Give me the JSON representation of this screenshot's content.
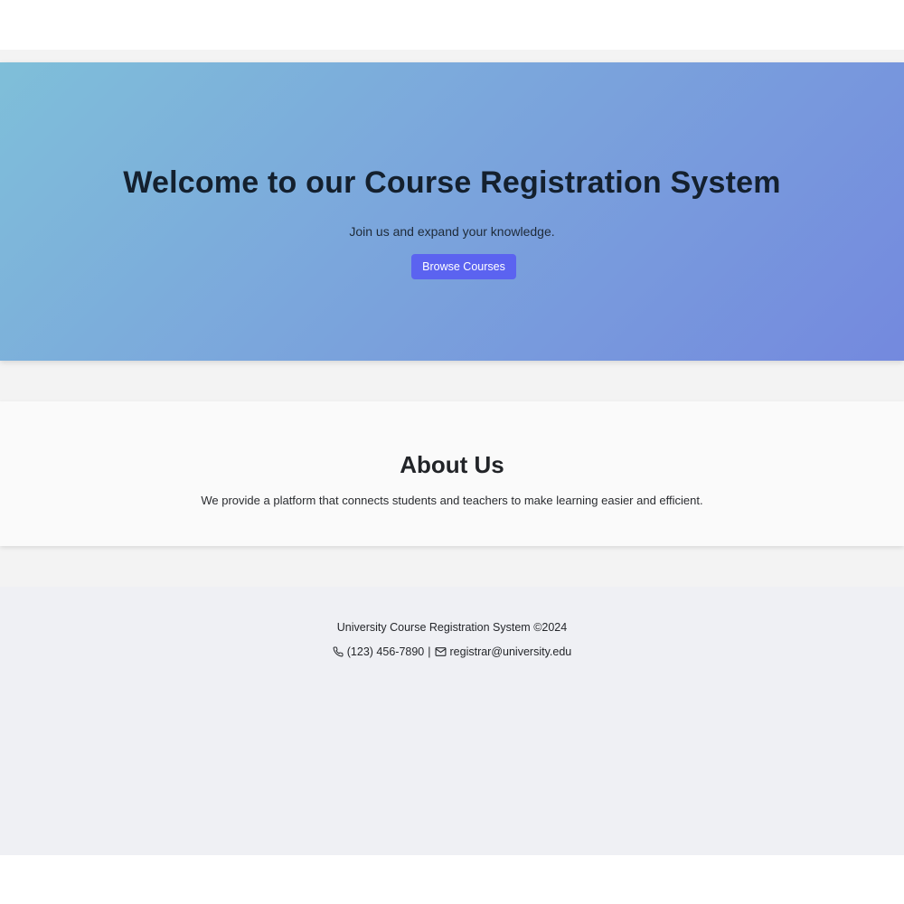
{
  "hero": {
    "title": "Welcome to our Course Registration System",
    "subtitle": "Join us and expand your knowledge.",
    "button_label": "Browse Courses"
  },
  "about": {
    "title": "About Us",
    "text": "We provide a platform that connects students and teachers to make learning easier and efficient."
  },
  "footer": {
    "copyright": "University Course Registration System ©2024",
    "phone": "(123) 456-7890",
    "separator": "|",
    "email": "registrar@university.edu",
    "phone_icon": "phone-icon",
    "email_icon": "mail-icon"
  },
  "colors": {
    "accent": "#5b63f0",
    "hero_gradient_start": "#7fbfd9",
    "hero_gradient_end": "#7489de"
  }
}
